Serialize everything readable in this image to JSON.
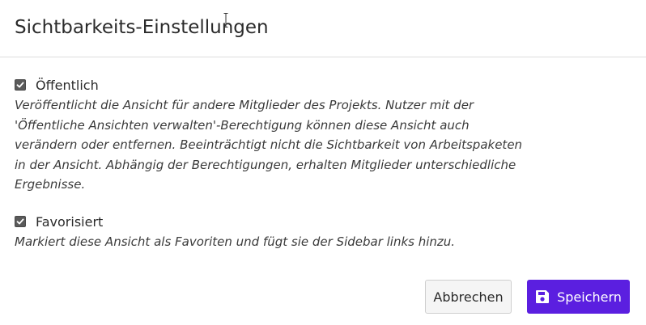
{
  "dialog": {
    "title": "Sichtbarkeits-Einstellungen"
  },
  "options": [
    {
      "label": "Öffentlich",
      "checked": true,
      "description": "Veröffentlicht die Ansicht für andere Mitglieder des Projekts. Nutzer mit der 'Öffentliche Ansichten verwalten'-Berechtigung können diese Ansicht auch verändern oder entfernen. Beeinträchtigt nicht die Sichtbarkeit von Arbeitspaketen in der Ansicht. Abhängig der Berechtigungen, erhalten Mitglieder unterschiedliche Ergebnisse."
    },
    {
      "label": "Favorisiert",
      "checked": true,
      "description": "Markiert diese Ansicht als Favoriten und fügt sie der Sidebar links hinzu."
    }
  ],
  "footer": {
    "cancel_label": "Abbrechen",
    "save_label": "Speichern",
    "save_icon": "floppy-disk-icon"
  },
  "colors": {
    "primary": "#5b1fe0",
    "checkbox": "#5a5a5a",
    "divider": "#dddddd"
  }
}
